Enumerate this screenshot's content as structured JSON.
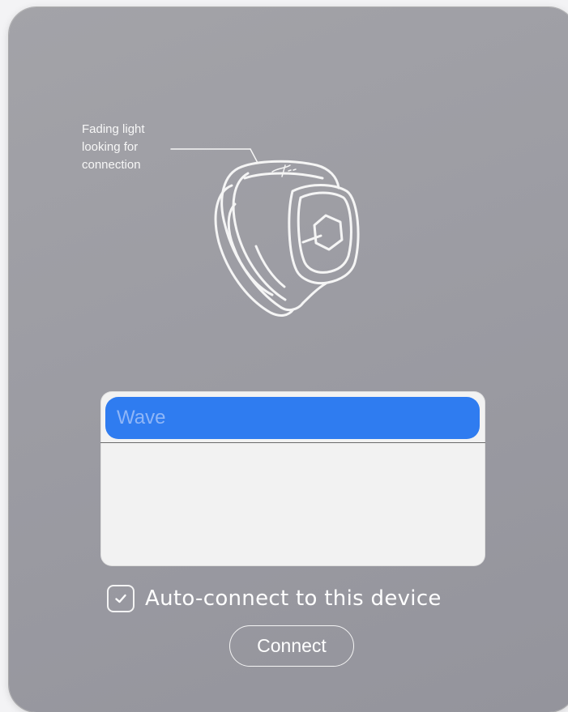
{
  "annotation": {
    "lines": [
      "Fading light",
      "looking for",
      "connection"
    ]
  },
  "device_list": {
    "items": [
      {
        "label": "Wave",
        "selected": true
      }
    ]
  },
  "auto_connect": {
    "label": "Auto-connect to this device",
    "checked": true
  },
  "connect_button": {
    "label": "Connect"
  },
  "icons": {
    "ring": "wave-ring-illustration-icon",
    "checkbox": "checkmark-icon"
  },
  "colors": {
    "window_background": "#9e9ea5",
    "selection": "#2f7cf0",
    "selection_text": "#8fb6f7",
    "list_background": "#f2f2f2",
    "foreground": "#ffffff"
  }
}
